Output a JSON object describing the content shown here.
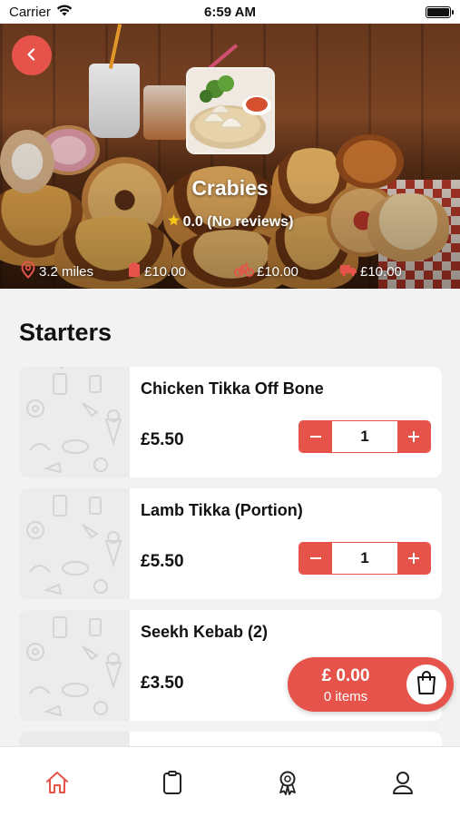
{
  "status_bar": {
    "carrier": "Carrier",
    "time": "6:59 AM"
  },
  "restaurant": {
    "name": "Crabies",
    "rating": "0.0 (No reviews)",
    "distance": "3.2 miles",
    "min_order": "£10.00",
    "collection_fee": "£10.00",
    "delivery_fee": "£10.00"
  },
  "menu": {
    "section_title": "Starters",
    "items": [
      {
        "name": "Chicken Tikka Off Bone",
        "price": "£5.50",
        "quantity": "1"
      },
      {
        "name": "Lamb Tikka (Portion)",
        "price": "£5.50",
        "quantity": "1"
      },
      {
        "name": "Seekh Kebab (2)",
        "price": "£3.50"
      }
    ]
  },
  "cart": {
    "total": "£ 0.00",
    "items": "0 items"
  },
  "icons": {
    "back": "chevron-left-icon",
    "location": "location-pin-icon",
    "min_order": "bag-icon",
    "collection": "bicycle-icon",
    "delivery": "truck-icon",
    "cart": "shopping-bag-icon",
    "tabs": [
      "home-icon",
      "clipboard-icon",
      "award-icon",
      "user-icon"
    ]
  },
  "colors": {
    "accent": "#e5534b",
    "background": "#f2f2f2",
    "card": "#ffffff",
    "tab_active": "#e5534b",
    "tab_inactive": "#222222"
  }
}
